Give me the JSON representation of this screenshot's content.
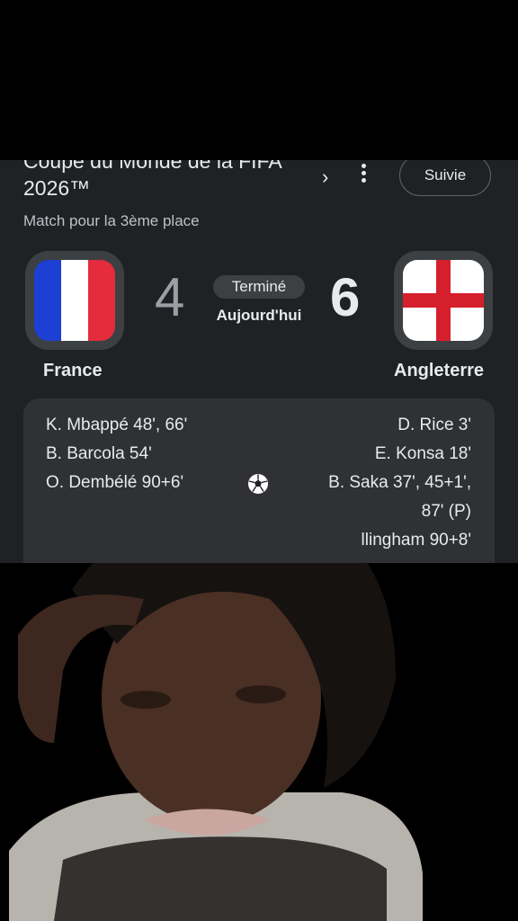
{
  "header": {
    "title_line1": "Coupe du Monde de la FIFA",
    "title_line2": "2026™",
    "follow_label": "Suivie",
    "subtitle": "Match pour la 3ème place"
  },
  "match": {
    "home_team": "France",
    "away_team": "Angleterre",
    "home_score": "4",
    "away_score": "6",
    "status": "Terminé",
    "date": "Aujourd'hui"
  },
  "scorers": {
    "home": [
      "K. Mbappé 48', 66'",
      "B. Barcola 54'",
      "O. Dembélé 90+6'"
    ],
    "away": [
      "D. Rice 3'",
      "E. Konsa 18'",
      "B. Saka 37', 45+1',",
      "87' (P)",
      "llingham 90+8'"
    ]
  },
  "icons": {
    "chevron": "chevron-right-icon",
    "menu": "more-vert-icon",
    "goal": "soccer-ball-icon"
  },
  "colors": {
    "card_bg": "#202124",
    "scorers_bg": "#303134",
    "france_blue": "#1e3fd3",
    "france_red": "#e42c3c",
    "england_red": "#d61f2c"
  }
}
